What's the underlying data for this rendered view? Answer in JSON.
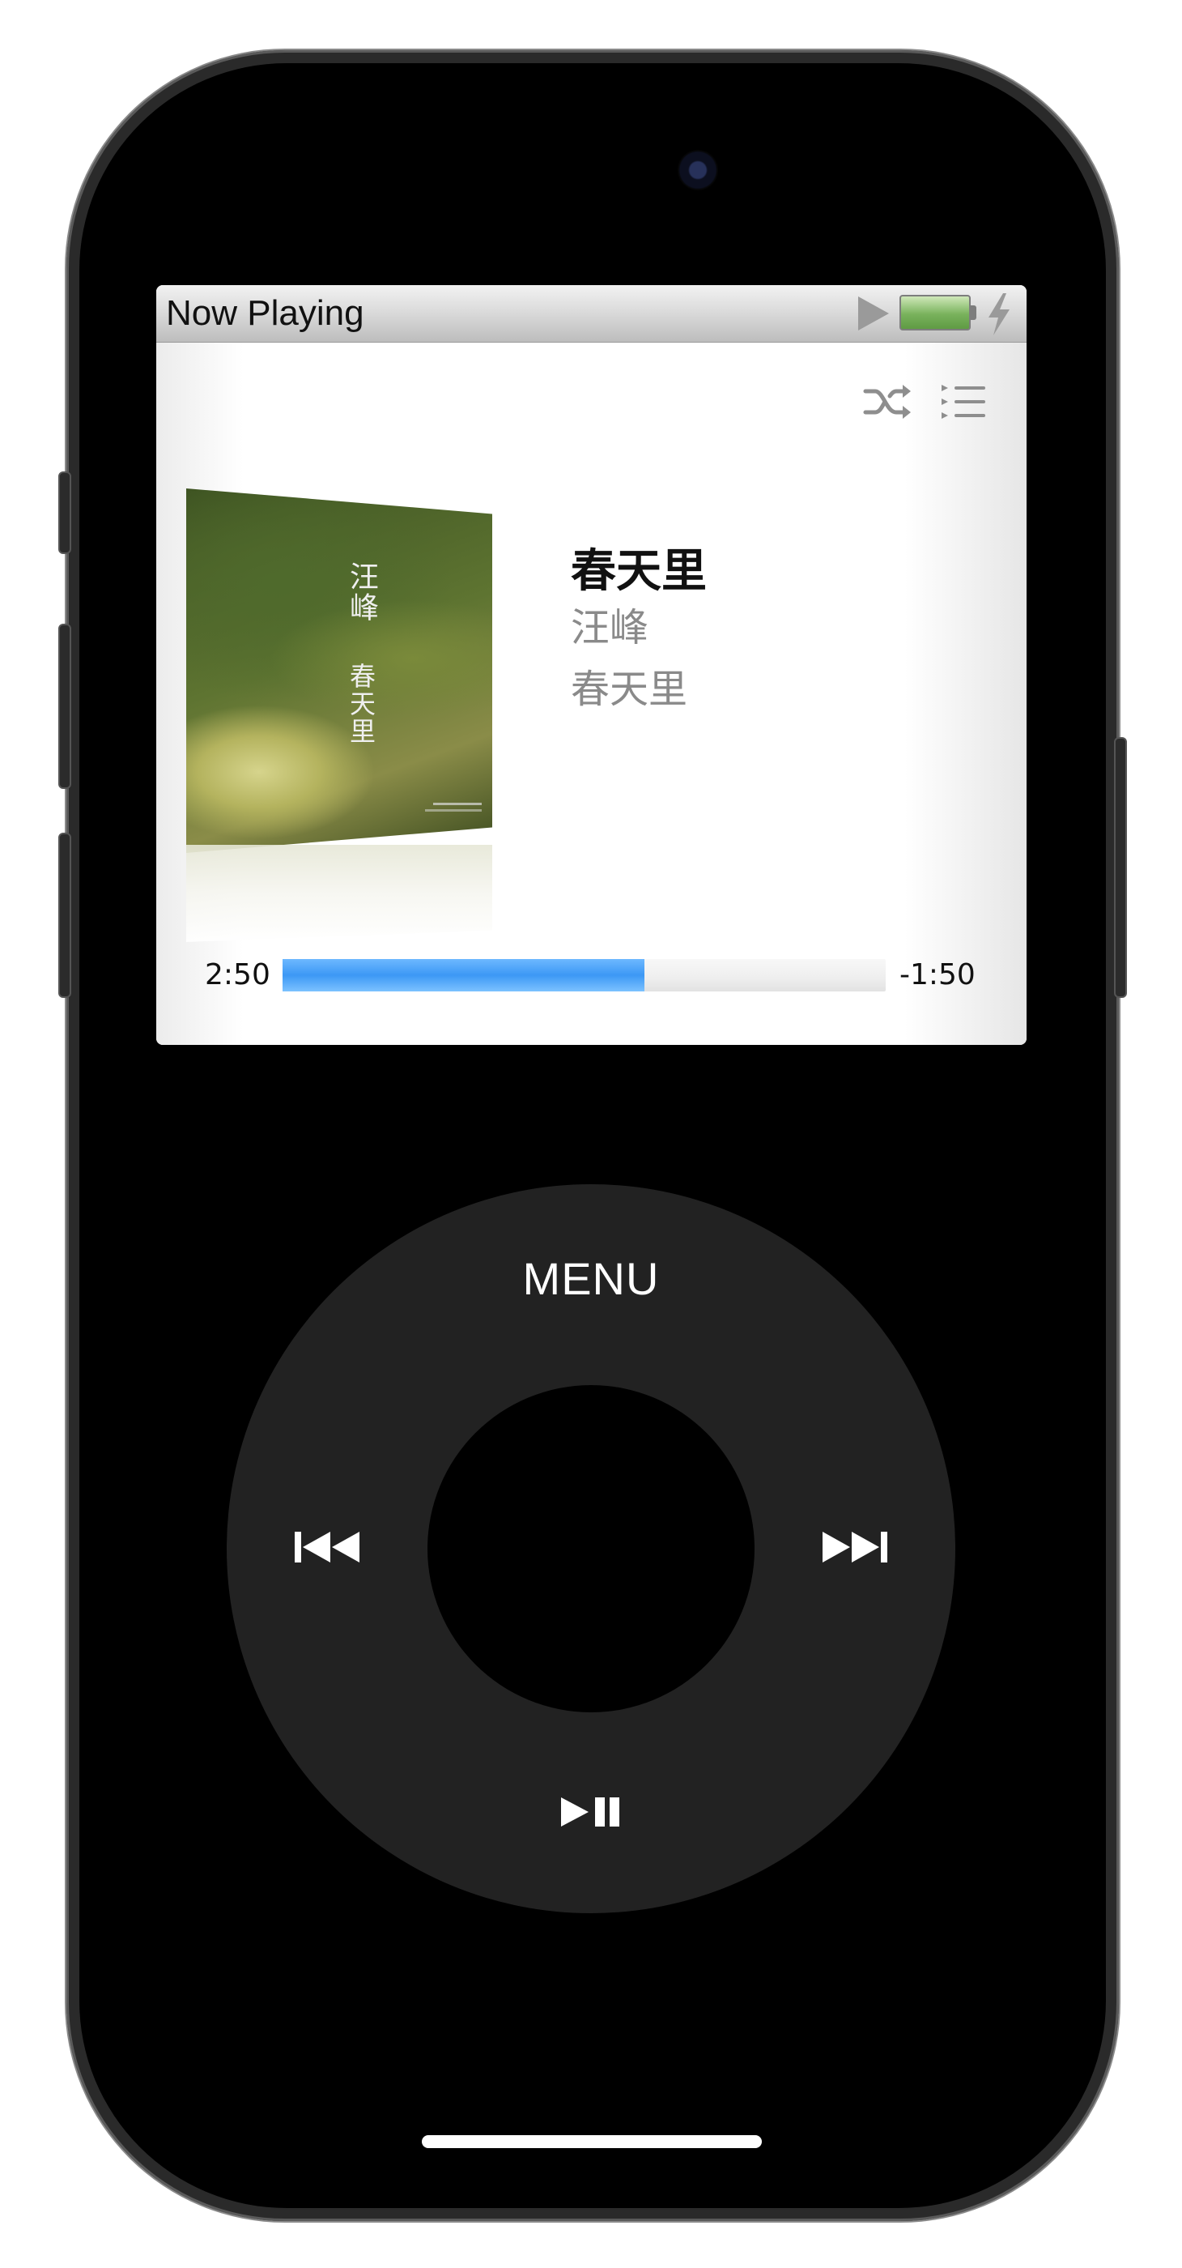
{
  "header": {
    "title": "Now Playing"
  },
  "track": {
    "title": "春天里",
    "artist": "汪峰",
    "album": "春天里"
  },
  "album_art": {
    "artist_text": "汪峰",
    "album_text": "春天里"
  },
  "playback": {
    "elapsed": "2:50",
    "remaining": "-1:50",
    "progress": 0.6
  },
  "wheel": {
    "menu_label": "MENU"
  },
  "icons": {
    "play_status": "play-icon",
    "battery": "battery-icon",
    "charging": "charging-bolt-icon",
    "shuffle": "shuffle-icon",
    "playlist": "playlist-icon",
    "previous": "previous-track-icon",
    "next": "next-track-icon",
    "play_pause": "play-pause-icon"
  },
  "colors": {
    "progress_fill": "#3c98f5",
    "wheel": "#222222",
    "battery": "#79b25c"
  }
}
